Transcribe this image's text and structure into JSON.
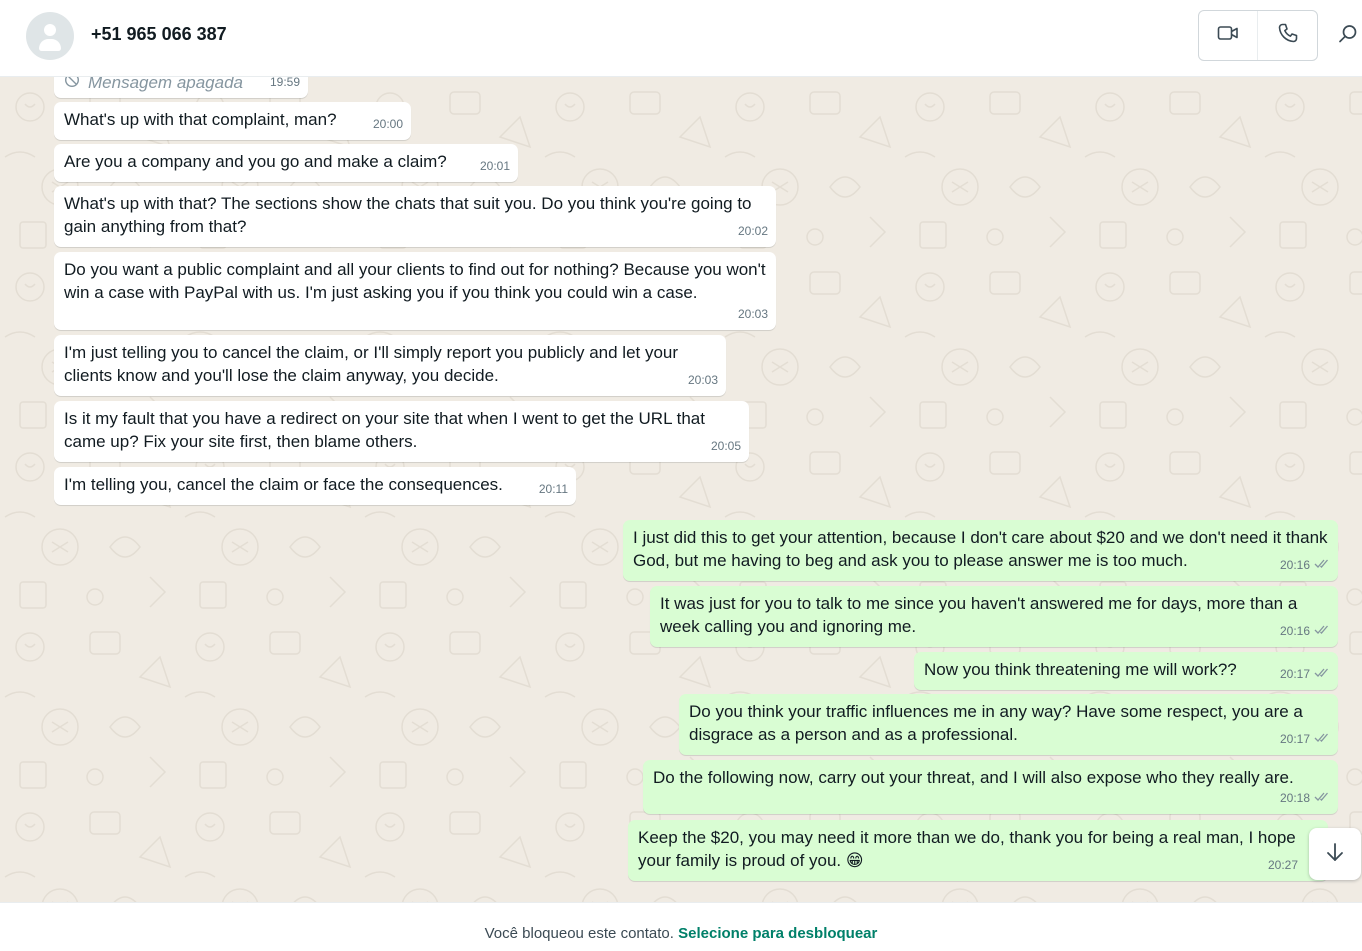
{
  "header": {
    "contact_name": "+51 965 066 387",
    "icons": [
      "avatar-placeholder",
      "video-call-icon",
      "voice-call-icon",
      "search-icon"
    ]
  },
  "messages": [
    {
      "direction": "in",
      "deleted": true,
      "text": "Mensagem apagada",
      "time": "19:59"
    },
    {
      "direction": "in",
      "text": "What's up with that complaint, man?",
      "time": "20:00"
    },
    {
      "direction": "in",
      "text": "Are you a company and you go and make a claim?",
      "time": "20:01"
    },
    {
      "direction": "in",
      "text": "What's up with that? The sections show the chats that suit you. Do you think you're going to gain anything from that?",
      "time": "20:02"
    },
    {
      "direction": "in",
      "text": "Do you want a public complaint and all your clients to find out for nothing? Because you won't win a case with PayPal with us. I'm just asking you if you think you could win a case.",
      "time": "20:03"
    },
    {
      "direction": "in",
      "text": "I'm just telling you to cancel the claim, or I'll simply report you publicly and let your clients know and you'll lose the claim anyway, you decide.",
      "time": "20:03"
    },
    {
      "direction": "in",
      "text": "Is it my fault that you have a redirect on your site that when I went to get the URL that came up? Fix your site first, then blame others.",
      "time": "20:05"
    },
    {
      "direction": "in",
      "text": "I'm telling you, cancel the claim or face the consequences.",
      "time": "20:11"
    },
    {
      "direction": "out",
      "text": "I just did this to get your attention, because I don't care about $20 and we don't need it thank God, but me having to beg and ask you to please answer me is too much.",
      "time": "20:16",
      "status": "read"
    },
    {
      "direction": "out",
      "text": "It was just for you to talk to me since you haven't answered me for days, more than a week calling you and ignoring me.",
      "time": "20:16",
      "status": "read"
    },
    {
      "direction": "out",
      "text": "Now you think threatening me will work??",
      "time": "20:17",
      "status": "read"
    },
    {
      "direction": "out",
      "text": "Do you think your traffic influences me in any way? Have some respect, you are a disgrace as a person and as a professional.",
      "time": "20:17",
      "status": "read"
    },
    {
      "direction": "out",
      "text": "Do the following now, carry out your threat, and I will also expose who they really are.",
      "time": "20:18",
      "status": "read"
    },
    {
      "direction": "out",
      "text": "Keep the $20, you may need it more than we do, thank you for being a real man, I hope your family is proud of you. 😁",
      "time": "20:27",
      "status": "read"
    }
  ],
  "footer": {
    "blocked_text": "Você bloqueou este contato.",
    "unblock_link": "Selecione para desbloquear"
  },
  "colors": {
    "chat_background": "#f0ebe3",
    "incoming_bubble": "#ffffff",
    "outgoing_bubble": "#d9fdd3",
    "accent_green": "#008069",
    "timestamp_gray": "#667781"
  }
}
